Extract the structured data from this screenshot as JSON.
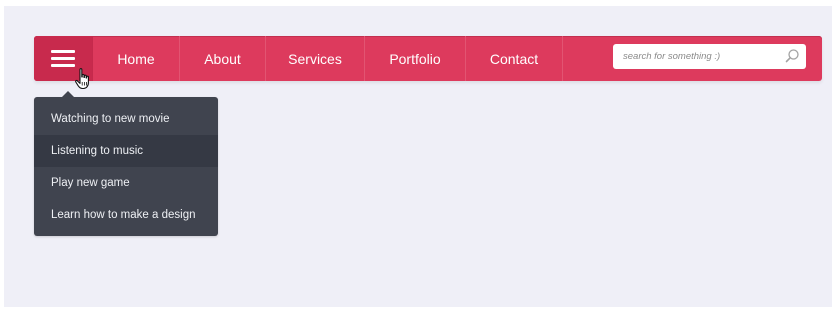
{
  "navbar": {
    "menu_icon": "hamburger-icon",
    "items": [
      {
        "label": "Home"
      },
      {
        "label": "About"
      },
      {
        "label": "Services"
      },
      {
        "label": "Portfolio"
      },
      {
        "label": "Contact"
      }
    ],
    "search": {
      "placeholder": "search for something :)",
      "icon": "search-icon"
    }
  },
  "dropdown": {
    "items": [
      {
        "label": "Watching to new movie"
      },
      {
        "label": "Listening to music"
      },
      {
        "label": "Play new game"
      },
      {
        "label": "Learn how to make a design"
      }
    ]
  },
  "colors": {
    "navbar_bg": "#dd3a5d",
    "toggle_bg": "#c82a4d",
    "dropdown_bg": "#40444f",
    "dropdown_active_bg": "#353944",
    "page_bg": "#efeff7"
  },
  "cursor_icon": "hand-pointer-icon"
}
